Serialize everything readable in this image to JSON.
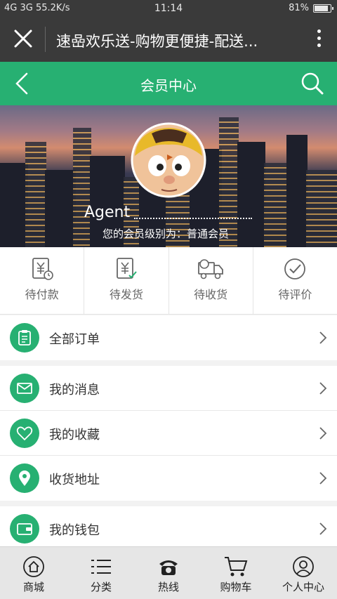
{
  "status_bar": {
    "left": "4G 3G 55.2K/s",
    "time": "11:14",
    "battery": "81%"
  },
  "browser": {
    "title": "速喦欢乐送-购物更便捷-配送..."
  },
  "header": {
    "title": "会员中心"
  },
  "profile": {
    "name": "Agent",
    "level_text": "您的会员级别为：普通会员"
  },
  "order_status": [
    {
      "label": "待付款",
      "icon": "payment-icon"
    },
    {
      "label": "待发货",
      "icon": "shipping-pending-icon"
    },
    {
      "label": "待收货",
      "icon": "truck-icon"
    },
    {
      "label": "待评价",
      "icon": "review-check-icon"
    }
  ],
  "menu": [
    {
      "label": "全部订单",
      "icon": "clipboard-icon"
    },
    {
      "label": "我的消息",
      "icon": "envelope-icon"
    },
    {
      "label": "我的收藏",
      "icon": "heart-icon"
    },
    {
      "label": "收货地址",
      "icon": "location-pin-icon"
    },
    {
      "label": "我的钱包",
      "icon": "wallet-icon"
    }
  ],
  "bottom_nav": [
    {
      "label": "商城",
      "icon": "home-icon"
    },
    {
      "label": "分类",
      "icon": "list-icon"
    },
    {
      "label": "热线",
      "icon": "phone-icon"
    },
    {
      "label": "购物车",
      "icon": "cart-icon"
    },
    {
      "label": "个人中心",
      "icon": "user-icon"
    }
  ],
  "colors": {
    "brand_green": "#27b072",
    "dark_bar": "#3a3a3a"
  }
}
